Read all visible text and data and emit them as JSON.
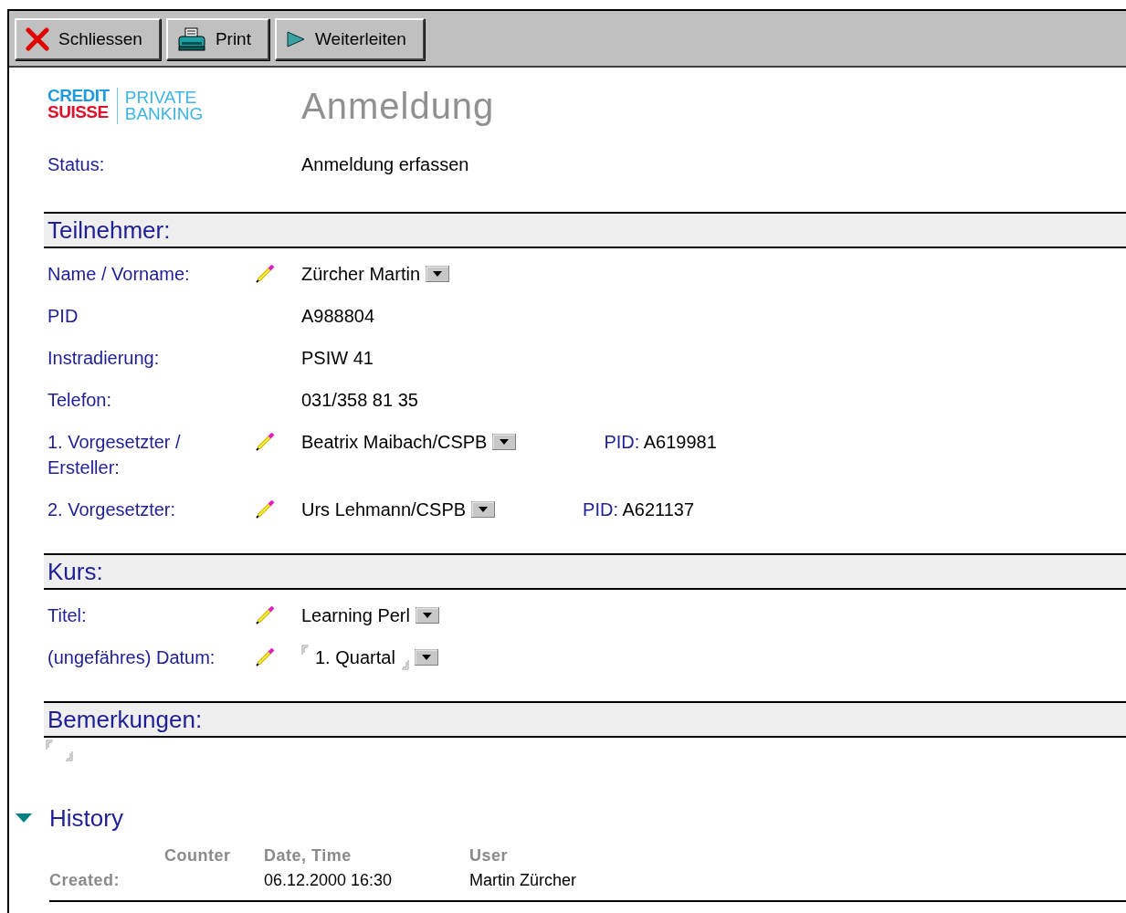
{
  "toolbar": [
    {
      "label": "Schliessen"
    },
    {
      "label": "Print"
    },
    {
      "label": "Weiterleiten"
    }
  ],
  "logo": {
    "line_1": "CREDIT",
    "line_2": "SUISSE",
    "line_3": "PRIVATE",
    "line_4": "BANKING"
  },
  "title": "Anmeldung",
  "status": {
    "label": "Status:",
    "value": "Anmeldung erfassen"
  },
  "sections": [
    {
      "heading": "Teilnehmer:",
      "kind": "fields",
      "fields": [
        {
          "label": "Name / Vorname:",
          "editable": true,
          "value": "Zürcher Martin",
          "dropdown": true
        },
        {
          "label": "PID",
          "editable": false,
          "value": "A988804",
          "dropdown": false
        },
        {
          "label": "Instradierung:",
          "editable": false,
          "value": "PSIW 41",
          "dropdown": false
        },
        {
          "label": "Telefon:",
          "editable": false,
          "value": "031/358 81 35",
          "dropdown": false
        },
        {
          "label": "1. Vorgesetzter / Ersteller:",
          "editable": true,
          "value": "Beatrix Maibach/CSPB",
          "dropdown": true,
          "pid_label": "PID:",
          "pid_value": "A619981"
        },
        {
          "label": "2. Vorgesetzter:",
          "editable": true,
          "value": "Urs Lehmann/CSPB",
          "dropdown": true,
          "pid_label": "PID:",
          "pid_value": "A621137"
        }
      ]
    },
    {
      "heading": "Kurs:",
      "kind": "fields",
      "fields": [
        {
          "label": "Titel:",
          "editable": true,
          "value": "Learning Perl",
          "dropdown": true
        },
        {
          "label": "(ungefähres) Datum:",
          "editable": true,
          "value": "1. Quartal",
          "dropdown": true,
          "bracketed": true
        }
      ]
    },
    {
      "heading": "Bemerkungen:",
      "kind": "memo"
    }
  ],
  "history": {
    "title": "History",
    "expanded": true,
    "columns": [
      "Counter",
      "Date, Time",
      "User"
    ],
    "rows": [
      {
        "label": "Created:",
        "date": "06.12.2000 16:30",
        "user": "Martin Zürcher"
      }
    ]
  }
}
